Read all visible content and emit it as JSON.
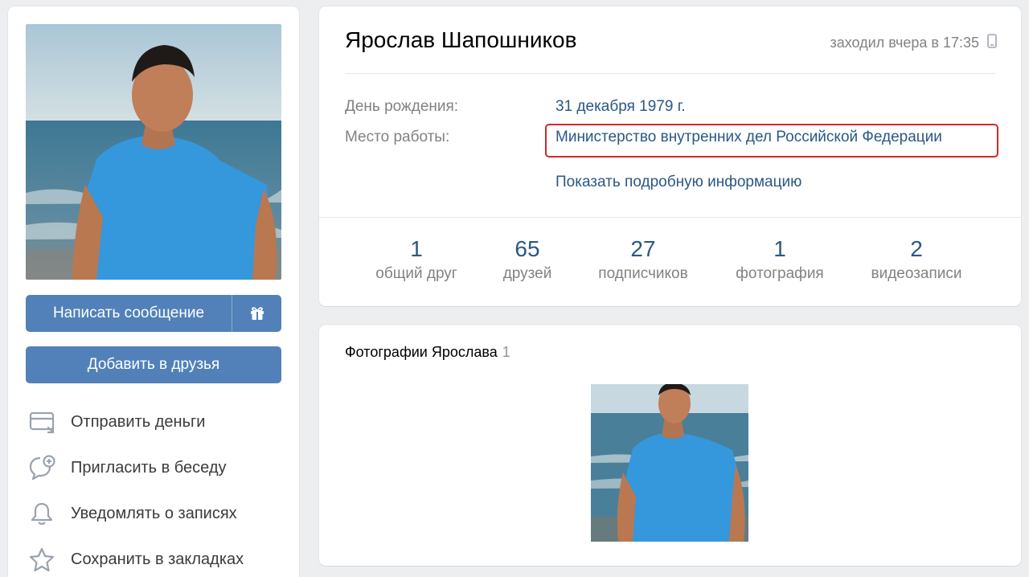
{
  "profile": {
    "name": "Ярослав Шапошников",
    "last_seen": "заходил вчера в 17:35",
    "last_seen_icon": "mobile-phone-icon",
    "birthday_label": "День рождения:",
    "birthday_value": "31 декабря 1979 г.",
    "work_label": "Место работы:",
    "work_value": "Министерство внутренних дел Российской Федерации",
    "show_more": "Показать подробную информацию"
  },
  "counters": [
    {
      "value": "1",
      "label": "общий друг"
    },
    {
      "value": "65",
      "label": "друзей"
    },
    {
      "value": "27",
      "label": "подписчиков"
    },
    {
      "value": "1",
      "label": "фотография"
    },
    {
      "value": "2",
      "label": "видеозаписи"
    }
  ],
  "buttons": {
    "message": "Написать сообщение",
    "gift_icon": "gift-icon",
    "add_friend": "Добавить в друзья"
  },
  "actions": [
    {
      "label": "Отправить деньги",
      "icon": "send-money-icon"
    },
    {
      "label": "Пригласить в беседу",
      "icon": "invite-chat-icon"
    },
    {
      "label": "Уведомлять о записях",
      "icon": "bell-icon"
    },
    {
      "label": "Сохранить в закладках",
      "icon": "star-icon"
    }
  ],
  "photos": {
    "title": "Фотографии Ярослава",
    "count": "1"
  },
  "colors": {
    "accent": "#5181b8",
    "link": "#2a5885",
    "highlight_border": "#d4282a",
    "background": "#edeef0"
  }
}
